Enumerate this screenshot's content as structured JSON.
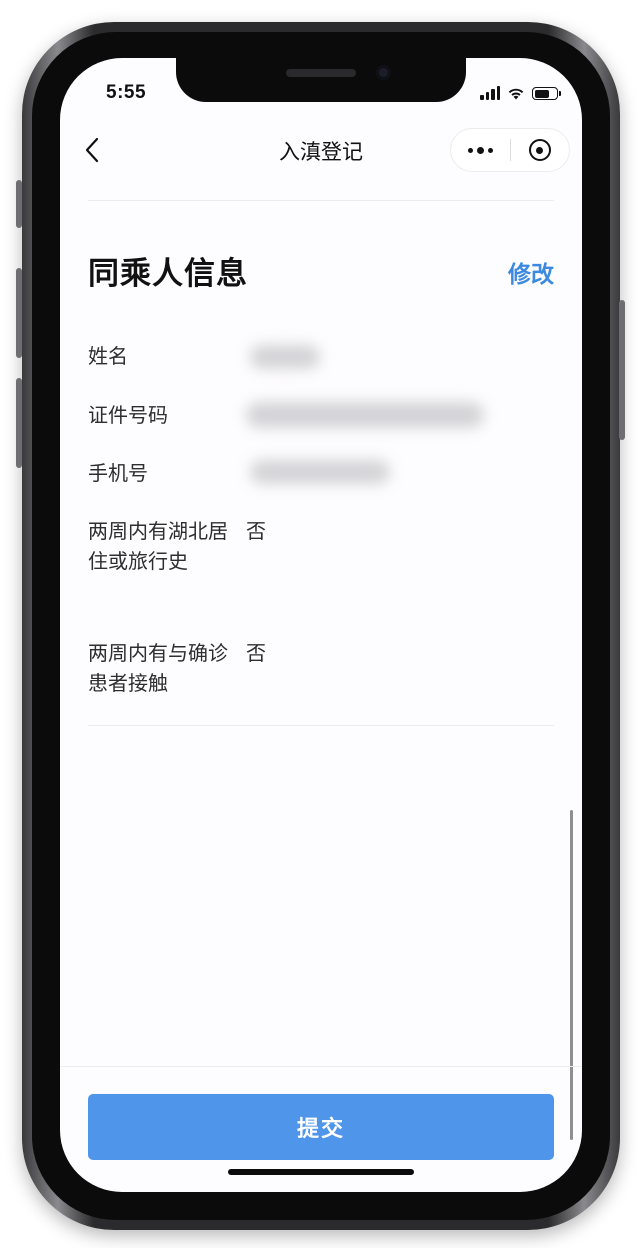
{
  "status_bar": {
    "time": "5:55"
  },
  "nav": {
    "title": "入滇登记"
  },
  "section": {
    "title": "同乘人信息",
    "edit_label": "修改"
  },
  "fields": [
    {
      "label": "姓名",
      "value": ""
    },
    {
      "label": "证件号码",
      "value": ""
    },
    {
      "label": "手机号",
      "value": ""
    },
    {
      "label": "两周内有湖北居住或旅行史",
      "value": "否"
    },
    {
      "label": "两周内有与确诊患者接触",
      "value": "否"
    }
  ],
  "submit": {
    "label": "提交",
    "color": "#4f95ea"
  },
  "colors": {
    "accent": "#3c8ae0",
    "background": "#fdfcfe"
  },
  "icons": [
    "back-chevron-icon",
    "more-dots-icon",
    "close-target-icon",
    "signal-icon",
    "wifi-icon",
    "battery-icon"
  ]
}
